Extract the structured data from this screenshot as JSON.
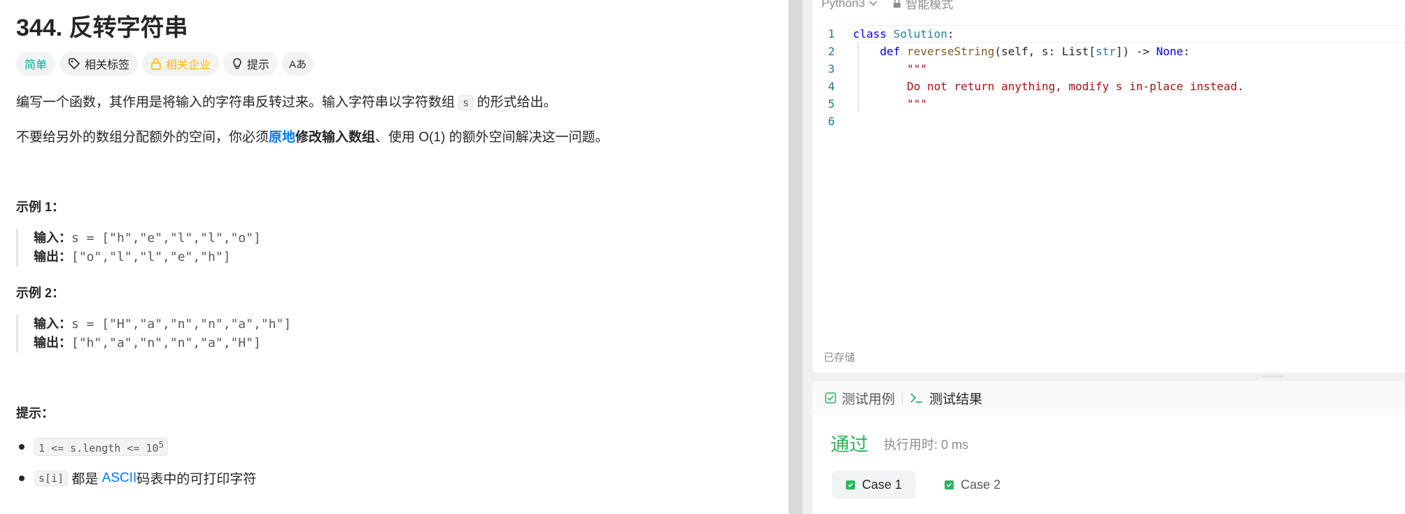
{
  "problem": {
    "title": "344. 反转字符串",
    "tags": {
      "difficulty": "简单",
      "related_tags": "相关标签",
      "related_companies": "相关企业",
      "hint": "提示",
      "translate": "Aあ"
    },
    "desc1_before": "编写一个函数，其作用是将输入的字符串反转过来。输入字符串以字符数组 ",
    "desc1_code": "s",
    "desc1_after": " 的形式给出。",
    "desc2_before": "不要给另外的数组分配额外的空间，你必须",
    "desc2_link": "原地",
    "desc2_bold": "修改输入数组",
    "desc2_after": "、使用 O(1) 的额外空间解决这一问题。",
    "examples": [
      {
        "heading": "示例 1：",
        "input_label": "输入：",
        "input": "s = [\"h\",\"e\",\"l\",\"l\",\"o\"]",
        "output_label": "输出：",
        "output": "[\"o\",\"l\",\"l\",\"e\",\"h\"]"
      },
      {
        "heading": "示例 2：",
        "input_label": "输入：",
        "input": "s = [\"H\",\"a\",\"n\",\"n\",\"a\",\"h\"]",
        "output_label": "输出：",
        "output": "[\"h\",\"a\",\"n\",\"n\",\"a\",\"H\"]"
      }
    ],
    "hints_heading": "提示：",
    "constraint1_code": "1 <= s.length <= 10",
    "constraint1_sup": "5",
    "constraint2_code": "s[i]",
    "constraint2_text_before": " 都是 ",
    "constraint2_link": "ASCII",
    "constraint2_text_after": " 码表中的可打印字符"
  },
  "editor": {
    "language": "Python3",
    "mode": "智能模式",
    "line_numbers": [
      "1",
      "2",
      "3",
      "4",
      "5",
      "6"
    ],
    "saved_status": "已存储"
  },
  "results": {
    "tab_testcase": "测试用例",
    "tab_result": "测试结果",
    "status": "通过",
    "runtime": "执行用时: 0 ms",
    "cases": [
      "Case 1",
      "Case 2"
    ]
  },
  "colors": {
    "easy": "#00af9b",
    "company": "#ffb800",
    "link": "#007aff",
    "pass": "#2db55d"
  }
}
